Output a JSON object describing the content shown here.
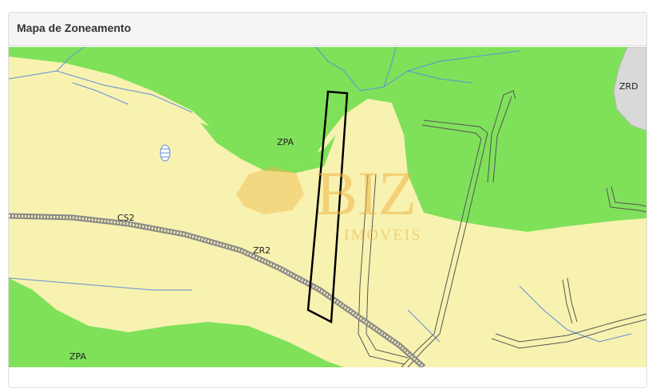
{
  "panel": {
    "title": "Mapa de Zoneamento"
  },
  "map": {
    "colors": {
      "zone_green": "#7fe15a",
      "zone_yellow": "#f8f2b0",
      "zone_gray": "#d9d9d9",
      "water": "#5f8fd6",
      "parcel": "#000000"
    },
    "labels": {
      "zpa_top": "ZPA",
      "zrd": "ZRD",
      "cs2": "CS2",
      "zr2": "ZR2",
      "zpa_bottom": "ZPA"
    },
    "watermark": {
      "brand": "BIZ",
      "subtitle": "IMÓVEIS"
    }
  }
}
